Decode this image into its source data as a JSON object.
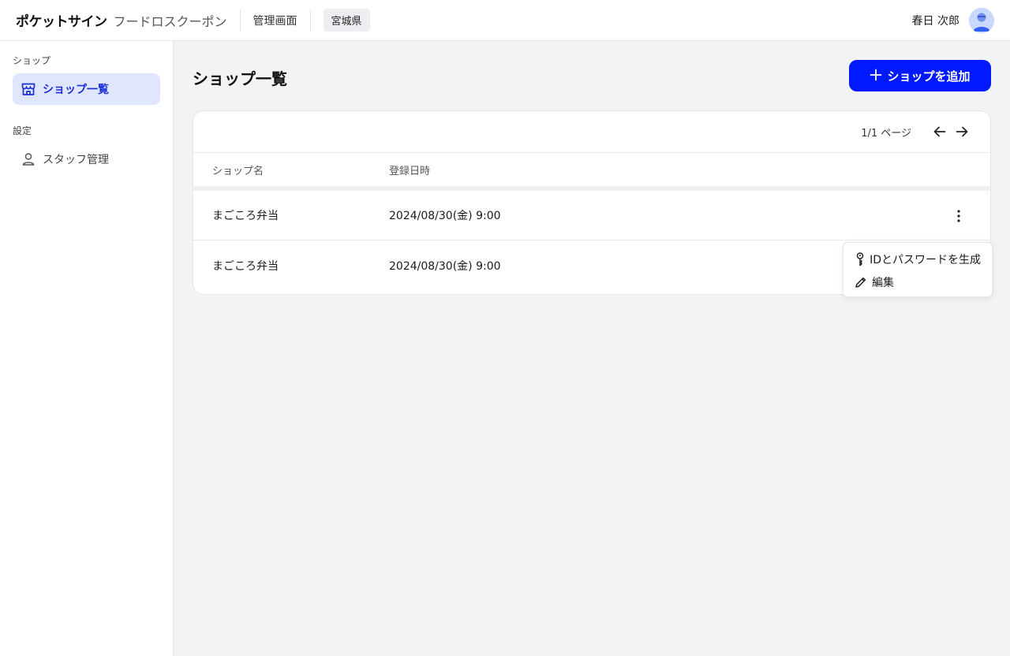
{
  "header": {
    "brand": "ポケットサイン",
    "product": "フードロスクーポン",
    "admin_label": "管理画面",
    "prefecture": "宮城県",
    "user_name": "春日 次郎"
  },
  "sidebar": {
    "sections": [
      {
        "title": "ショップ",
        "items": [
          {
            "label": "ショップ一覧",
            "icon": "store-icon",
            "active": true
          }
        ]
      },
      {
        "title": "設定",
        "items": [
          {
            "label": "スタッフ管理",
            "icon": "person-icon",
            "active": false
          }
        ]
      }
    ]
  },
  "main": {
    "title": "ショップ一覧",
    "add_button_label": "ショップを追加",
    "pager_text": "1/1 ページ",
    "table": {
      "columns": [
        "ショップ名",
        "登録日時"
      ],
      "rows": [
        {
          "name": "まごころ弁当",
          "registered": "2024/08/30(金) 9:00"
        },
        {
          "name": "まごころ弁当",
          "registered": "2024/08/30(金) 9:00"
        }
      ]
    }
  },
  "context_menu": {
    "items": [
      {
        "label": "IDとパスワードを生成",
        "icon": "key-icon"
      },
      {
        "label": "編集",
        "icon": "pencil-icon"
      }
    ]
  },
  "colors": {
    "accent": "#0019ff",
    "sidebar_active_bg": "#e1e6ff",
    "sidebar_active_text": "#1a2fd6",
    "background": "#f2f3f5"
  }
}
